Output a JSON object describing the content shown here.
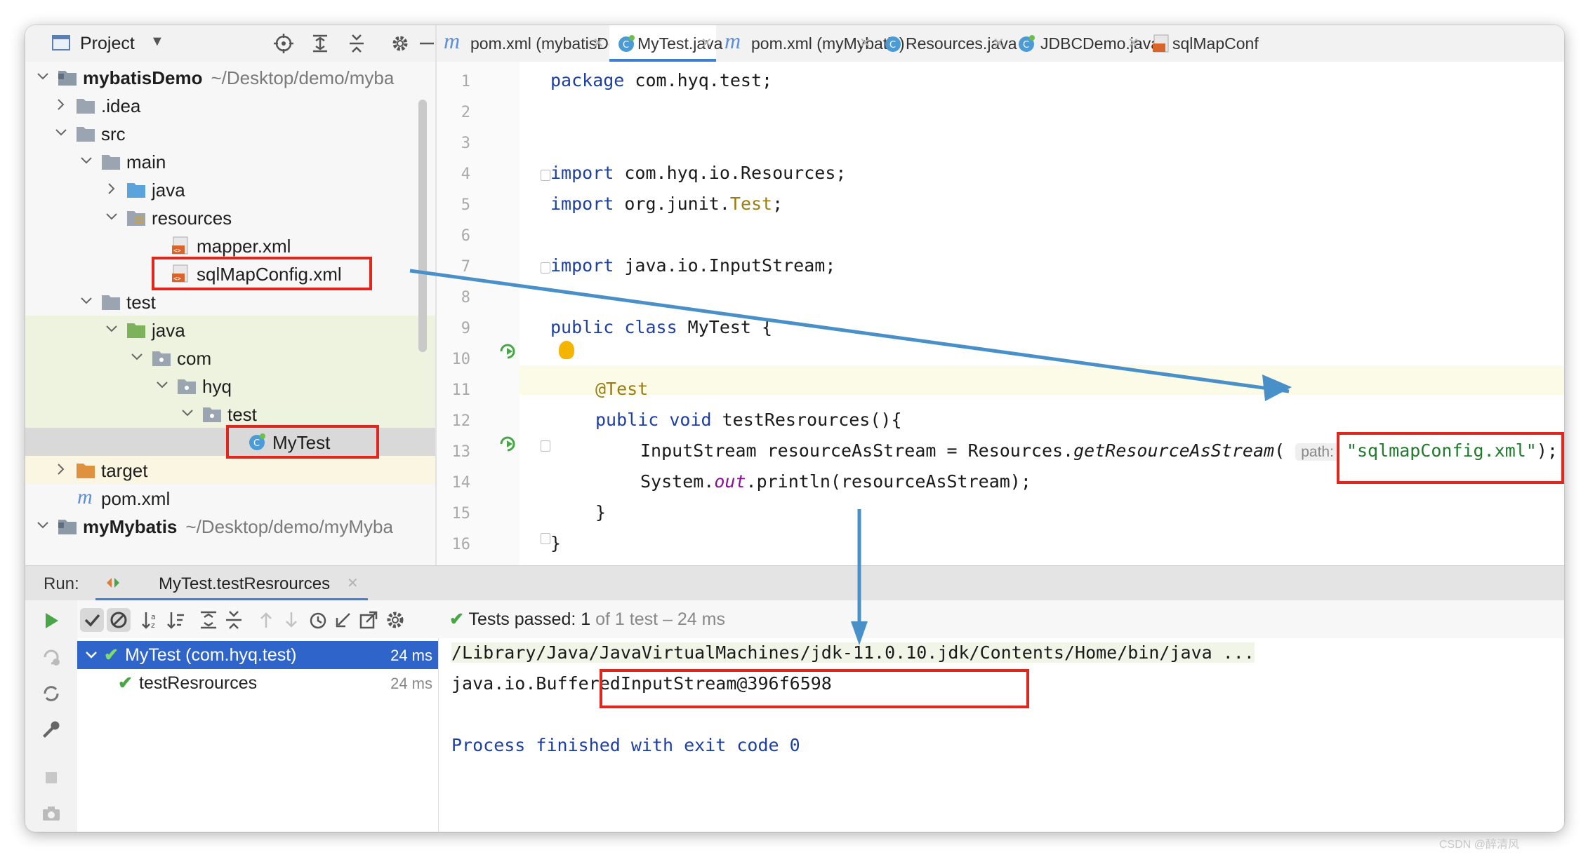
{
  "project_panel": {
    "title": "Project",
    "tree": [
      {
        "label": "mybatisDemo",
        "path": "~/Desktop/demo/myba"
      },
      {
        "label": ".idea"
      },
      {
        "label": "src"
      },
      {
        "label": "main"
      },
      {
        "label": "java"
      },
      {
        "label": "resources"
      },
      {
        "label": "mapper.xml"
      },
      {
        "label": "sqlMapConfig.xml"
      },
      {
        "label": "test"
      },
      {
        "label": "java"
      },
      {
        "label": "com"
      },
      {
        "label": "hyq"
      },
      {
        "label": "test"
      },
      {
        "label": "MyTest"
      },
      {
        "label": "target"
      },
      {
        "label": "pom.xml"
      },
      {
        "label": "myMybatis",
        "path": "~/Desktop/demo/myMyba"
      }
    ]
  },
  "editor": {
    "tabs": [
      {
        "label": "pom.xml (mybatisDemo)",
        "icon": "maven-icon"
      },
      {
        "label": "MyTest.java",
        "icon": "java-class-icon",
        "active": true
      },
      {
        "label": "pom.xml (myMybatis)",
        "icon": "maven-icon"
      },
      {
        "label": "Resources.java",
        "icon": "java-class-icon"
      },
      {
        "label": "JDBCDemo.java",
        "icon": "java-class-icon"
      },
      {
        "label": "sqlMapConf",
        "icon": "xml-file-icon"
      }
    ],
    "line_numbers": [
      "1",
      "2",
      "3",
      "4",
      "5",
      "6",
      "7",
      "8",
      "9",
      "10",
      "11",
      "12",
      "13",
      "14",
      "15",
      "16"
    ],
    "code": {
      "l1_kw": "package",
      "l1_rest": " com.hyq.test;",
      "l4_kw": "import",
      "l4_rest": " com.hyq.io.Resources;",
      "l5_kw": "import",
      "l5_mid": " org.junit.",
      "l5_ann": "Test",
      "l5_end": ";",
      "l7_kw": "import",
      "l7_rest": " java.io.InputStream;",
      "l9_kw": "public class",
      "l9_rest": " MyTest {",
      "l11_ann": "@Test",
      "l12_kw": "public void",
      "l12_rest": " testResrources(){",
      "l13_a": "InputStream resourceAsStream = Resources.",
      "l13_method": "getResourceAsStream",
      "l13_paren": "(",
      "l13_hint": "path:",
      "l13_str": "\"sqlmapConfig.xml\"",
      "l13_end": ");",
      "l14_a": "System.",
      "l14_field": "out",
      "l14_b": ".println(resourceAsStream);",
      "l15": "}",
      "l16": "}"
    }
  },
  "run_panel": {
    "run_label": "Run:",
    "tab_label": "MyTest.testResrources",
    "status_passed": "Tests passed:",
    "status_count": "1",
    "status_rest": "of 1 test – 24 ms",
    "results": [
      {
        "label": "MyTest (com.hyq.test)",
        "time": "24 ms"
      },
      {
        "label": "testResrources",
        "time": "24 ms"
      }
    ],
    "console": [
      "/Library/Java/JavaVirtualMachines/jdk-11.0.10.jdk/Contents/Home/bin/java ...",
      "java.io.BufferedInputStream@396f6598",
      "",
      "Process finished with exit code 0"
    ]
  },
  "watermark": "CSDN @醉清风",
  "colors": {
    "accent": "#3d7fd6",
    "selection": "#2f65ca",
    "highlight_box": "#e0271e",
    "arrow": "#4a90c8",
    "pass_green": "#49a646"
  }
}
